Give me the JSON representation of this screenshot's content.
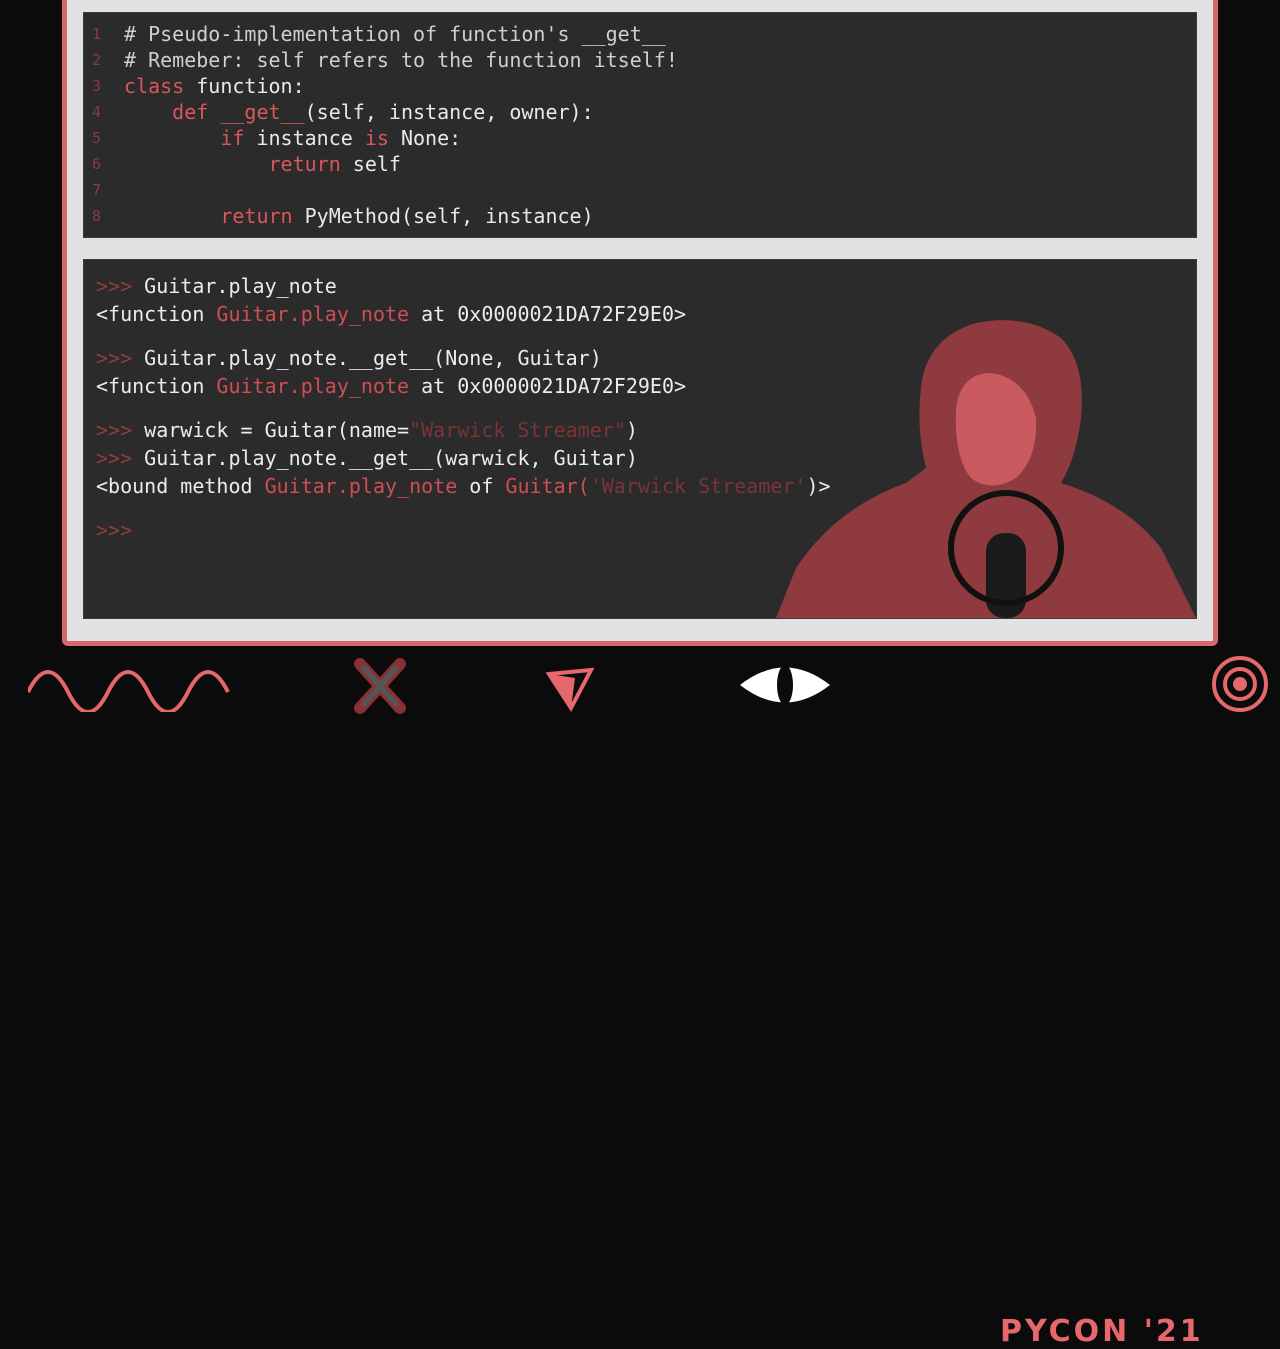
{
  "code": {
    "lines": [
      {
        "n": "1",
        "parts": [
          {
            "t": "# Pseudo-implementation of function's __get__",
            "c": "cm"
          }
        ]
      },
      {
        "n": "2",
        "parts": [
          {
            "t": "# Remeber: self refers to the function itself!",
            "c": "cm"
          }
        ]
      },
      {
        "n": "3",
        "parts": [
          {
            "t": "class ",
            "c": "kw"
          },
          {
            "t": "function:",
            "c": ""
          }
        ]
      },
      {
        "n": "4",
        "parts": [
          {
            "t": "    def ",
            "c": "kw"
          },
          {
            "t": "__get__",
            "c": "fn"
          },
          {
            "t": "(self, instance, owner):",
            "c": ""
          }
        ]
      },
      {
        "n": "5",
        "parts": [
          {
            "t": "        if ",
            "c": "kw"
          },
          {
            "t": "instance ",
            "c": ""
          },
          {
            "t": "is ",
            "c": "kw"
          },
          {
            "t": "None:",
            "c": ""
          }
        ]
      },
      {
        "n": "6",
        "parts": [
          {
            "t": "            return ",
            "c": "kw"
          },
          {
            "t": "self",
            "c": ""
          }
        ]
      },
      {
        "n": "7",
        "parts": [
          {
            "t": "",
            "c": ""
          }
        ]
      },
      {
        "n": "8",
        "parts": [
          {
            "t": "        return ",
            "c": "kw"
          },
          {
            "t": "PyMethod(self, instance)",
            "c": ""
          }
        ]
      }
    ]
  },
  "console": {
    "lines": [
      [
        {
          "t": ">>> ",
          "c": "prompt"
        },
        {
          "t": "Guitar.play_note",
          "c": ""
        }
      ],
      [
        {
          "t": "<function ",
          "c": ""
        },
        {
          "t": "Guitar.play_note",
          "c": "red"
        },
        {
          "t": " at 0x0000021DA72F29E0>",
          "c": ""
        }
      ],
      [
        {
          "t": ">>> ",
          "c": "prompt"
        },
        {
          "t": "Guitar.play_note.__get__(None, Guitar)",
          "c": ""
        }
      ],
      [
        {
          "t": "<function ",
          "c": ""
        },
        {
          "t": "Guitar.play_note",
          "c": "red"
        },
        {
          "t": " at 0x0000021DA72F29E0>",
          "c": ""
        }
      ],
      [
        {
          "t": ">>> ",
          "c": "prompt"
        },
        {
          "t": "warwick = Guitar(name=",
          "c": ""
        },
        {
          "t": "\"Warwick Streamer\"",
          "c": "dim"
        },
        {
          "t": ")",
          "c": ""
        }
      ],
      [
        {
          "t": ">>> ",
          "c": "prompt"
        },
        {
          "t": "Guitar.play_note.__get__(warwick, Guitar)",
          "c": ""
        }
      ],
      [
        {
          "t": "<bound method ",
          "c": ""
        },
        {
          "t": "Guitar.play_note",
          "c": "red"
        },
        {
          "t": " of ",
          "c": ""
        },
        {
          "t": "Guitar(",
          "c": "red"
        },
        {
          "t": "'Warwick Streamer'",
          "c": "dim"
        },
        {
          "t": ")>",
          "c": ""
        }
      ],
      [
        {
          "t": ">>>",
          "c": "prompt"
        }
      ]
    ]
  },
  "branding": {
    "event": "PYCON '21"
  },
  "icons": [
    "wave-icon",
    "x-icon",
    "triangle-pen-icon",
    "eye-icon",
    "target-icon"
  ],
  "colors": {
    "accent": "#d6676b",
    "code_bg": "#2b2b2b"
  }
}
